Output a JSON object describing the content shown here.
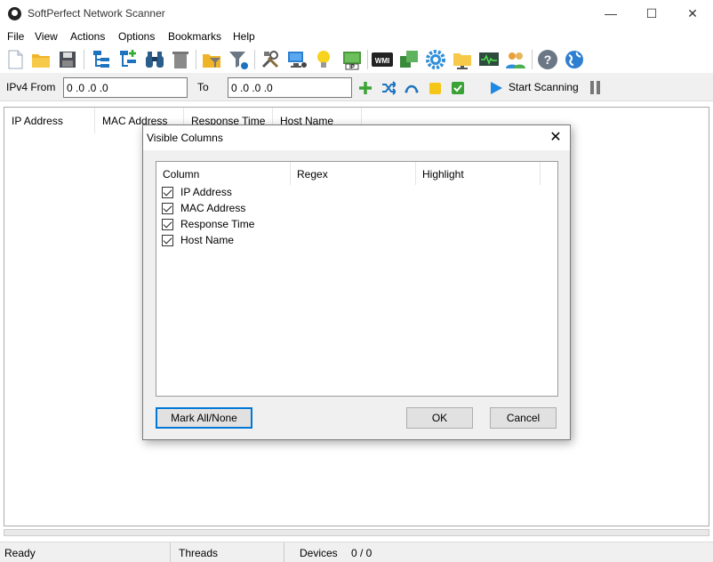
{
  "window": {
    "title": "SoftPerfect Network Scanner",
    "minimize": "—",
    "maximize": "☐",
    "close": "✕"
  },
  "menu": [
    "File",
    "View",
    "Actions",
    "Options",
    "Bookmarks",
    "Help"
  ],
  "toolbar": {
    "icons": [
      "new-file-icon",
      "open-folder-icon",
      "save-icon",
      "tree-view-icon",
      "add-tree-icon",
      "binoculars-icon",
      "delete-icon",
      "folder-filter-icon",
      "filter-icon",
      "tools-icon",
      "remote-computer-icon",
      "lightbulb-icon",
      "ip-card-icon",
      "wmi-icon",
      "grid-tile-icon",
      "settings-gear-icon",
      "shared-folder-icon",
      "network-monitor-icon",
      "users-icon",
      "help-icon",
      "globe-icon"
    ],
    "wmi_label": "WMI",
    "ip_label": "IP"
  },
  "range": {
    "from_label": "IPv4 From",
    "from_value": "0 .0 .0 .0",
    "to_label": "To",
    "to_value": "0 .0 .0 .0",
    "start_label": "Start Scanning"
  },
  "results": {
    "columns": [
      "IP Address",
      "MAC Address",
      "Response Time",
      "Host Name"
    ]
  },
  "status": {
    "state": "Ready",
    "threads_label": "Threads",
    "devices_label": "Devices",
    "devices_value": "0 / 0"
  },
  "dialog": {
    "title": "Visible Columns",
    "close": "✕",
    "headers": [
      "Column",
      "Regex",
      "Highlight"
    ],
    "rows": [
      {
        "label": "IP Address",
        "checked": true
      },
      {
        "label": "MAC Address",
        "checked": true
      },
      {
        "label": "Response Time",
        "checked": true
      },
      {
        "label": "Host Name",
        "checked": true
      }
    ],
    "mark_all_label": "Mark All/None",
    "ok_label": "OK",
    "cancel_label": "Cancel"
  }
}
